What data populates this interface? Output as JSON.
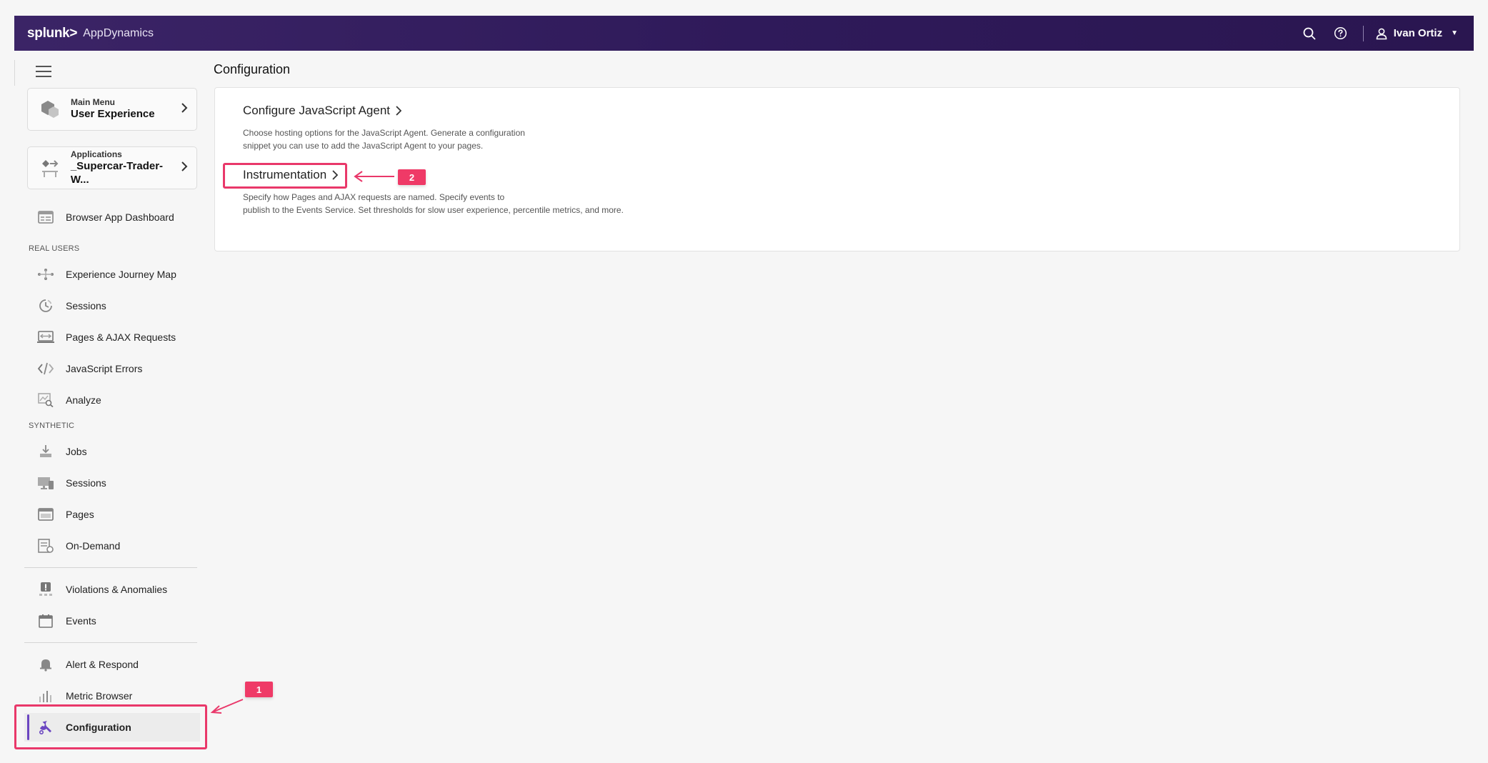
{
  "header": {
    "brand": "splunk>",
    "product": "AppDynamics",
    "user_name": "Ivan Ortiz",
    "icons": [
      "search-icon",
      "help-icon",
      "user-icon",
      "caret-down-icon"
    ]
  },
  "sidebar": {
    "main_menu": {
      "label": "Main Menu",
      "value": "User Experience"
    },
    "applications": {
      "label": "Applications",
      "value": "_Supercar-Trader-W..."
    },
    "dashboard_item": "Browser App Dashboard",
    "sections": {
      "real_users": "REAL USERS",
      "synthetic": "SYNTHETIC"
    },
    "real_users_items": [
      "Experience Journey Map",
      "Sessions",
      "Pages & AJAX Requests",
      "JavaScript Errors",
      "Analyze"
    ],
    "synthetic_items": [
      "Jobs",
      "Sessions",
      "Pages",
      "On-Demand"
    ],
    "monitoring_items": [
      "Violations & Anomalies",
      "Events"
    ],
    "tools_items": [
      "Alert & Respond",
      "Metric Browser",
      "Configuration"
    ],
    "active_item": "Configuration"
  },
  "main": {
    "page_title": "Configuration",
    "sections": [
      {
        "title": "Configure JavaScript Agent",
        "desc_line1": "Choose hosting options for the JavaScript Agent. Generate a configuration",
        "desc_line2": "snippet you can use to add the JavaScript Agent to your pages."
      },
      {
        "title": "Instrumentation",
        "desc_line1": "Specify how Pages and AJAX requests are named. Specify events to",
        "desc_line2": "publish to the Events Service. Set thresholds for slow user experience, percentile metrics, and more."
      }
    ]
  },
  "annotations": {
    "badge_1": "1",
    "badge_2": "2",
    "highlight_color": "#e9386a"
  },
  "colors": {
    "topbar": "#2f1a5a",
    "accent": "#6b46c1",
    "background": "#f6f6f6"
  }
}
